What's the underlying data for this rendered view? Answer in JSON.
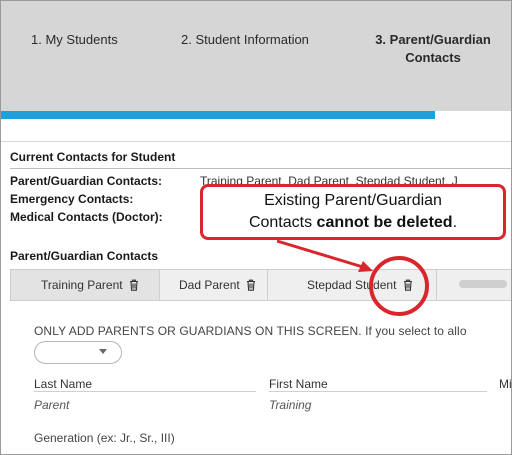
{
  "wizard": {
    "steps": [
      {
        "label": "1. My Students"
      },
      {
        "label": "2. Student Information"
      },
      {
        "label": "3. Parent/Guardian",
        "label_line2": "Contacts"
      }
    ],
    "active_step": 3,
    "accent_color": "#1ba1dd"
  },
  "current_contacts": {
    "heading": "Current Contacts for Student",
    "parent_guardian_label": "Parent/Guardian Contacts:",
    "parent_guardian_value": "Training Parent, Dad Parent, Stepdad Student, J",
    "emergency_label": "Emergency Contacts:",
    "medical_label": "Medical Contacts (Doctor):"
  },
  "section_title": "Parent/Guardian Contacts",
  "tabs": [
    {
      "label": "Training Parent",
      "icon": "trash-icon"
    },
    {
      "label": "Dad Parent",
      "icon": "trash-icon"
    },
    {
      "label": "Stepdad Student",
      "icon": "trash-icon"
    },
    {
      "label": "",
      "icon": ""
    }
  ],
  "notice": "ONLY ADD PARENTS OR GUARDIANS ON THIS SCREEN. If you select to allo",
  "generation_select": {
    "value": ""
  },
  "fields": {
    "last_name_label": "Last Name",
    "last_name_value": "Parent",
    "first_name_label": "First Name",
    "first_name_value": "Training",
    "middle_label": "Mi",
    "generation_label": "Generation (ex: Jr., Sr., III)"
  },
  "annotation": {
    "line1": "Existing Parent/Guardian",
    "line2_prefix": "Contacts ",
    "line2_bold": "cannot be deleted",
    "line2_suffix": ".",
    "color": "#d9262c"
  }
}
